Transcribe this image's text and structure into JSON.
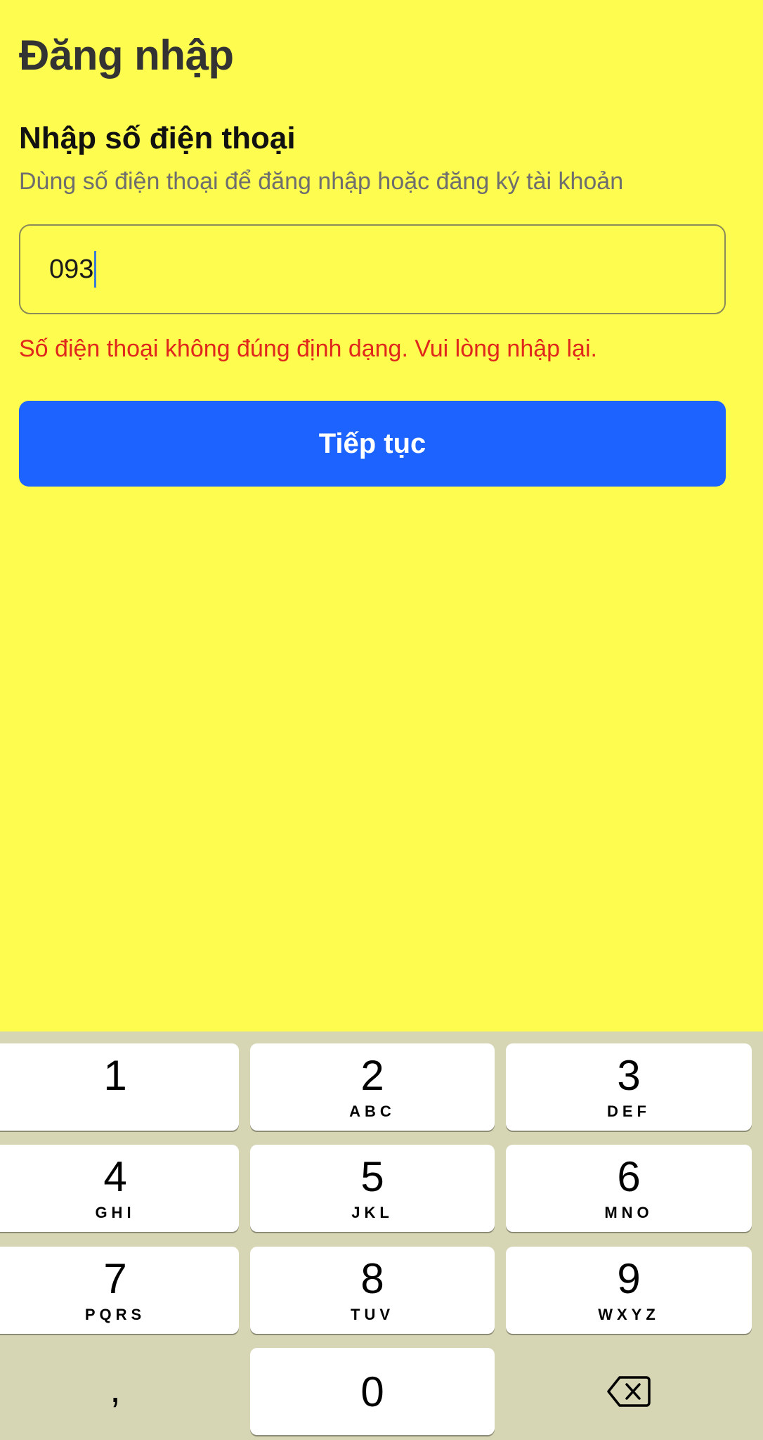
{
  "header": {
    "title": "Đăng nhập"
  },
  "form": {
    "heading": "Nhập số điện thoại",
    "subheading": "Dùng số điện thoại để đăng nhập hoặc đăng ký tài khoản",
    "phone_value": "093",
    "error_message": "Số điện thoại không đúng định dạng. Vui lòng nhập lại.",
    "submit_label": "Tiếp tục"
  },
  "keyboard": {
    "keys": [
      {
        "digit": "1",
        "letters": ""
      },
      {
        "digit": "2",
        "letters": "ABC"
      },
      {
        "digit": "3",
        "letters": "DEF"
      },
      {
        "digit": "4",
        "letters": "GHI"
      },
      {
        "digit": "5",
        "letters": "JKL"
      },
      {
        "digit": "6",
        "letters": "MNO"
      },
      {
        "digit": "7",
        "letters": "PQRS"
      },
      {
        "digit": "8",
        "letters": "TUV"
      },
      {
        "digit": "9",
        "letters": "WXYZ"
      }
    ],
    "comma_key": ",",
    "zero_key": "0",
    "delete_icon": "backspace-icon"
  },
  "colors": {
    "background": "#fefc4e",
    "primary_button": "#1c63ff",
    "error": "#e0271c",
    "keyboard_bg": "#d6d5b4"
  }
}
